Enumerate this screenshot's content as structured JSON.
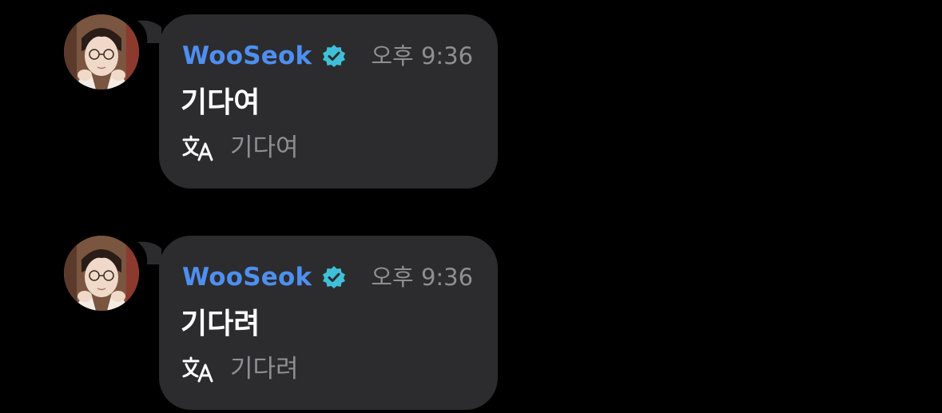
{
  "messages": [
    {
      "sender": "WooSeok",
      "verified": true,
      "timestamp": "오후 9:36",
      "text": "기다여",
      "translation": "기다여"
    },
    {
      "sender": "WooSeok",
      "verified": true,
      "timestamp": "오후 9:36",
      "text": "기다려",
      "translation": "기다려"
    }
  ],
  "colors": {
    "background": "#000000",
    "bubble": "#2c2c2e",
    "sender_name": "#4e8ff0",
    "verified_badge": "#3fc0d8",
    "timestamp": "#8e8e93",
    "message_text": "#ffffff",
    "translation_text": "#8e8e93"
  },
  "icons": {
    "verified": "verified-badge-icon",
    "translate": "translate-icon",
    "avatar": "user-avatar-photo"
  }
}
